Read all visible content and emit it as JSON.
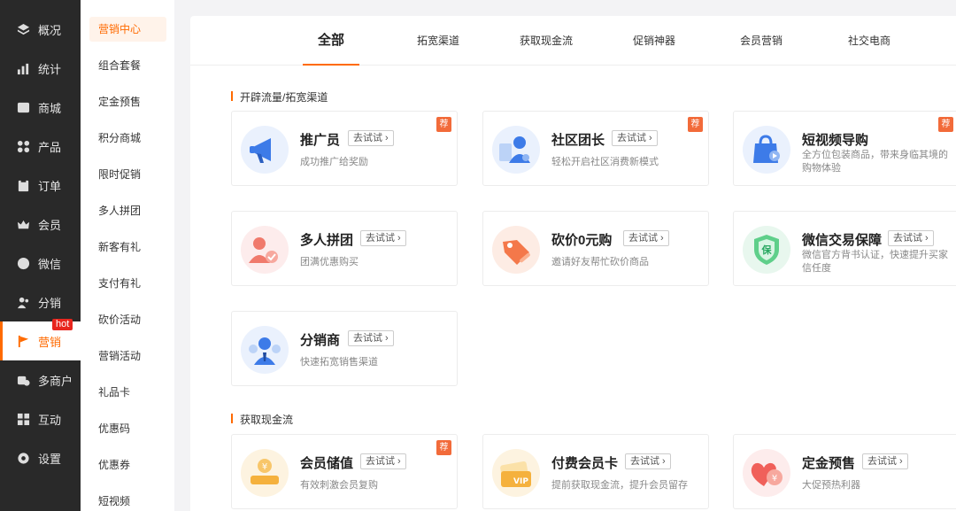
{
  "sidebar": {
    "items": [
      {
        "label": "概况",
        "icon": "layers-icon"
      },
      {
        "label": "统计",
        "icon": "bar-chart-icon"
      },
      {
        "label": "商城",
        "icon": "store-icon"
      },
      {
        "label": "产品",
        "icon": "grid-icon"
      },
      {
        "label": "订单",
        "icon": "clipboard-icon"
      },
      {
        "label": "会员",
        "icon": "crown-icon"
      },
      {
        "label": "微信",
        "icon": "chat-icon"
      },
      {
        "label": "分销",
        "icon": "users-icon"
      },
      {
        "label": "营销",
        "icon": "flag-icon"
      },
      {
        "label": "多商户",
        "icon": "shop-plus-icon"
      },
      {
        "label": "互动",
        "icon": "apps-icon"
      },
      {
        "label": "设置",
        "icon": "gear-icon"
      }
    ],
    "hot_badge": "hot"
  },
  "submenu": {
    "items": [
      "营销中心",
      "组合套餐",
      "定金预售",
      "积分商城",
      "限时促销",
      "多人拼团",
      "新客有礼",
      "支付有礼",
      "砍价活动",
      "营销活动",
      "礼品卡",
      "优惠码",
      "优惠券",
      "短视频"
    ]
  },
  "tabs": [
    "全部",
    "拓宽渠道",
    "获取现金流",
    "促销神器",
    "会员营销",
    "社交电商"
  ],
  "sections": [
    {
      "title": "开辟流量/拓宽渠道"
    },
    {
      "title": "获取现金流"
    }
  ],
  "try_label": "去试试 ›",
  "rec_label": "荐",
  "cards": [
    {
      "title": "推广员",
      "desc": "成功推广给奖励",
      "icon": "megaphone-icon"
    },
    {
      "title": "社区团长",
      "desc": "轻松开启社区消费新模式",
      "icon": "community-leader-icon"
    },
    {
      "title": "短视频导购",
      "desc": "全方位包装商品，带来身临其境的购物体验",
      "icon": "video-bag-icon"
    },
    {
      "title": "多人拼团",
      "desc": "团满优惠购买",
      "icon": "group-buy-icon"
    },
    {
      "title": "砍价0元购",
      "desc": "邀请好友帮忙砍价商品",
      "icon": "price-tag-icon"
    },
    {
      "title": "微信交易保障",
      "desc": "微信官方背书认证，快速提升买家信任度",
      "icon": "shield-icon"
    },
    {
      "title": "分销商",
      "desc": "快速拓宽销售渠道",
      "icon": "distributor-icon"
    },
    {
      "title": "会员储值",
      "desc": "有效刺激会员复购",
      "icon": "coin-icon"
    },
    {
      "title": "付费会员卡",
      "desc": "提前获取现金流，提升会员留存",
      "icon": "vip-card-icon"
    },
    {
      "title": "定金预售",
      "desc": "大促预热利器",
      "icon": "heart-yen-icon"
    }
  ],
  "colors": {
    "accent": "#ff6a00",
    "sidebar_bg": "#292929",
    "badge_red": "#e8261e"
  }
}
